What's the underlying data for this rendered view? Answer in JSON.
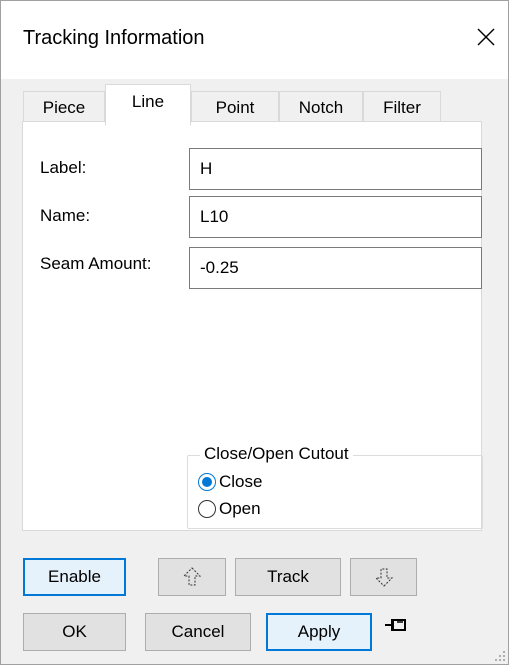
{
  "window": {
    "title": "Tracking Information"
  },
  "tabs": [
    "Piece",
    "Line",
    "Point",
    "Notch",
    "Filter"
  ],
  "active_tab": "Line",
  "fields": {
    "label": {
      "label": "Label:",
      "value": "H"
    },
    "name": {
      "label": "Name:",
      "value": "L10"
    },
    "seam": {
      "label": "Seam Amount:",
      "value": "-0.25"
    }
  },
  "cutout": {
    "title": "Close/Open Cutout",
    "options": [
      "Close",
      "Open"
    ],
    "selected": "Close"
  },
  "buttons": {
    "enable": "Enable",
    "track": "Track",
    "ok": "OK",
    "cancel": "Cancel",
    "apply": "Apply"
  },
  "icons": {
    "close": "close-icon",
    "prev": "arrow-up-icon",
    "next": "arrow-down-icon",
    "pin": "pin-icon"
  },
  "colors": {
    "accent": "#0078d7",
    "focused_bg": "#e5f1fb"
  }
}
